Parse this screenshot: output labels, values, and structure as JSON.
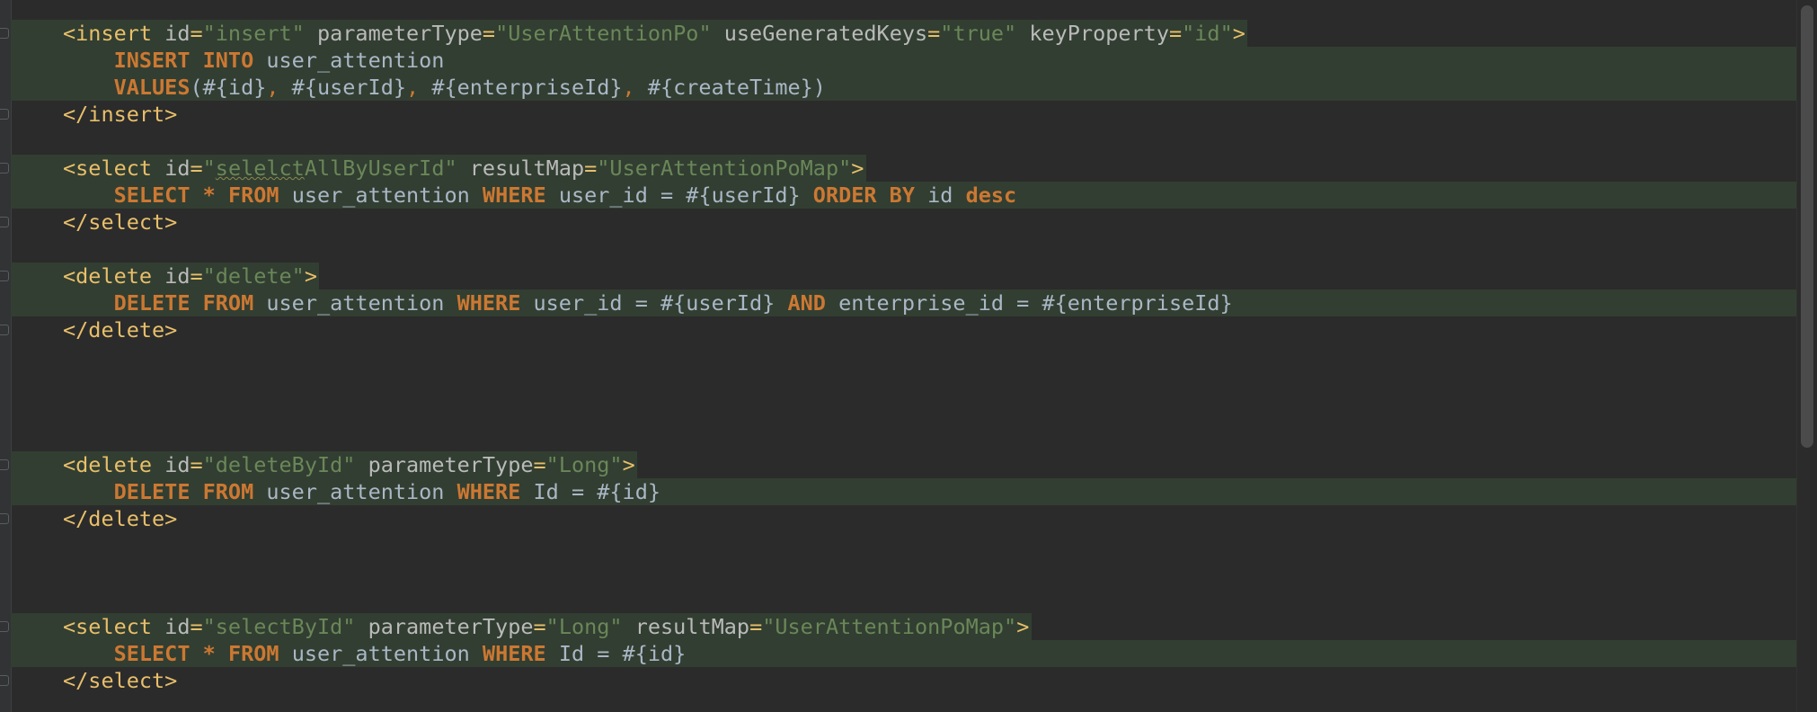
{
  "editor": {
    "language": "xml-mybatis-mapper",
    "colors": {
      "background": "#2b2b2b",
      "highlight": "#323e31",
      "tag": "#e8bf6a",
      "attribute": "#bababa",
      "string": "#6a8759",
      "keyword": "#cc7832",
      "text": "#a9b7c6"
    }
  },
  "lines": [
    {
      "tokens": [
        {
          "t": "tag",
          "v": "<insert "
        },
        {
          "t": "attr",
          "v": "id"
        },
        {
          "t": "tag",
          "v": "="
        },
        {
          "t": "val",
          "v": "\"insert\""
        },
        {
          "t": "plain",
          "v": " "
        },
        {
          "t": "attr",
          "v": "parameterType"
        },
        {
          "t": "tag",
          "v": "="
        },
        {
          "t": "val",
          "v": "\"UserAttentionPo\""
        },
        {
          "t": "plain",
          "v": " "
        },
        {
          "t": "attr",
          "v": "useGeneratedKeys"
        },
        {
          "t": "tag",
          "v": "="
        },
        {
          "t": "val",
          "v": "\"true\""
        },
        {
          "t": "plain",
          "v": " "
        },
        {
          "t": "attr",
          "v": "keyProperty"
        },
        {
          "t": "tag",
          "v": "="
        },
        {
          "t": "val",
          "v": "\"id\""
        },
        {
          "t": "tag",
          "v": ">"
        }
      ],
      "highlight": "partial",
      "fold": true
    },
    {
      "tokens": [
        {
          "t": "plain",
          "v": "    "
        },
        {
          "t": "kw",
          "v": "INSERT INTO"
        },
        {
          "t": "plain",
          "v": " user_attention"
        }
      ],
      "highlight": "full"
    },
    {
      "tokens": [
        {
          "t": "plain",
          "v": "    "
        },
        {
          "t": "kw",
          "v": "VALUES"
        },
        {
          "t": "plain",
          "v": "(#{id}"
        },
        {
          "t": "punc",
          "v": ", "
        },
        {
          "t": "plain",
          "v": "#{userId}"
        },
        {
          "t": "punc",
          "v": ", "
        },
        {
          "t": "plain",
          "v": "#{enterpriseId}"
        },
        {
          "t": "punc",
          "v": ", "
        },
        {
          "t": "plain",
          "v": "#{createTime})"
        }
      ],
      "highlight": "full"
    },
    {
      "tokens": [
        {
          "t": "tag",
          "v": "</insert>"
        }
      ],
      "highlight": "none",
      "fold": true
    },
    {
      "tokens": [],
      "highlight": "none"
    },
    {
      "tokens": [
        {
          "t": "tag",
          "v": "<select "
        },
        {
          "t": "attr",
          "v": "id"
        },
        {
          "t": "tag",
          "v": "="
        },
        {
          "t": "val",
          "v": "\""
        },
        {
          "t": "valwarn",
          "v": "selelct"
        },
        {
          "t": "val",
          "v": "AllByUserId\""
        },
        {
          "t": "plain",
          "v": " "
        },
        {
          "t": "attr",
          "v": "resultMap"
        },
        {
          "t": "tag",
          "v": "="
        },
        {
          "t": "val",
          "v": "\"UserAttentionPoMap\""
        },
        {
          "t": "tag",
          "v": ">"
        }
      ],
      "highlight": "partial",
      "fold": true
    },
    {
      "tokens": [
        {
          "t": "plain",
          "v": "    "
        },
        {
          "t": "kw",
          "v": "SELECT"
        },
        {
          "t": "plain",
          "v": " "
        },
        {
          "t": "kw",
          "v": "*"
        },
        {
          "t": "plain",
          "v": " "
        },
        {
          "t": "kw",
          "v": "FROM"
        },
        {
          "t": "plain",
          "v": " user_attention "
        },
        {
          "t": "kw",
          "v": "WHERE"
        },
        {
          "t": "plain",
          "v": " user_id = #{userId} "
        },
        {
          "t": "kw",
          "v": "ORDER BY"
        },
        {
          "t": "plain",
          "v": " id "
        },
        {
          "t": "kw",
          "v": "desc"
        }
      ],
      "highlight": "full"
    },
    {
      "tokens": [
        {
          "t": "tag",
          "v": "</select>"
        }
      ],
      "highlight": "none",
      "fold": true
    },
    {
      "tokens": [],
      "highlight": "none"
    },
    {
      "tokens": [
        {
          "t": "tag",
          "v": "<delete "
        },
        {
          "t": "attr",
          "v": "id"
        },
        {
          "t": "tag",
          "v": "="
        },
        {
          "t": "val",
          "v": "\"delete\""
        },
        {
          "t": "tag",
          "v": ">"
        }
      ],
      "highlight": "partial",
      "fold": true
    },
    {
      "tokens": [
        {
          "t": "plain",
          "v": "    "
        },
        {
          "t": "kw",
          "v": "DELETE FROM"
        },
        {
          "t": "plain",
          "v": " user_attention "
        },
        {
          "t": "kw",
          "v": "WHERE"
        },
        {
          "t": "plain",
          "v": " user_id = #{userId} "
        },
        {
          "t": "kw",
          "v": "AND"
        },
        {
          "t": "plain",
          "v": " enterprise_id = #{enterpriseId}"
        }
      ],
      "highlight": "full"
    },
    {
      "tokens": [
        {
          "t": "tag",
          "v": "</delete>"
        }
      ],
      "highlight": "none",
      "fold": true
    },
    {
      "tokens": [],
      "highlight": "none"
    },
    {
      "tokens": [],
      "highlight": "none"
    },
    {
      "tokens": [],
      "highlight": "none"
    },
    {
      "tokens": [],
      "highlight": "none"
    },
    {
      "tokens": [
        {
          "t": "tag",
          "v": "<delete "
        },
        {
          "t": "attr",
          "v": "id"
        },
        {
          "t": "tag",
          "v": "="
        },
        {
          "t": "val",
          "v": "\"deleteById\""
        },
        {
          "t": "plain",
          "v": " "
        },
        {
          "t": "attr",
          "v": "parameterType"
        },
        {
          "t": "tag",
          "v": "="
        },
        {
          "t": "val",
          "v": "\"Long\""
        },
        {
          "t": "tag",
          "v": ">"
        }
      ],
      "highlight": "partial",
      "fold": true
    },
    {
      "tokens": [
        {
          "t": "plain",
          "v": "    "
        },
        {
          "t": "kw",
          "v": "DELETE FROM"
        },
        {
          "t": "plain",
          "v": " user_attention "
        },
        {
          "t": "kw",
          "v": "WHERE"
        },
        {
          "t": "plain",
          "v": " Id = #{id}"
        }
      ],
      "highlight": "full"
    },
    {
      "tokens": [
        {
          "t": "tag",
          "v": "</delete>"
        }
      ],
      "highlight": "none",
      "fold": true
    },
    {
      "tokens": [],
      "highlight": "none"
    },
    {
      "tokens": [],
      "highlight": "none"
    },
    {
      "tokens": [],
      "highlight": "none"
    },
    {
      "tokens": [
        {
          "t": "tag",
          "v": "<select "
        },
        {
          "t": "attr",
          "v": "id"
        },
        {
          "t": "tag",
          "v": "="
        },
        {
          "t": "val",
          "v": "\"selectById\""
        },
        {
          "t": "plain",
          "v": " "
        },
        {
          "t": "attr",
          "v": "parameterType"
        },
        {
          "t": "tag",
          "v": "="
        },
        {
          "t": "val",
          "v": "\"Long\""
        },
        {
          "t": "plain",
          "v": " "
        },
        {
          "t": "attr",
          "v": "resultMap"
        },
        {
          "t": "tag",
          "v": "="
        },
        {
          "t": "val",
          "v": "\"UserAttentionPoMap\""
        },
        {
          "t": "tag",
          "v": ">"
        }
      ],
      "highlight": "partial",
      "fold": true
    },
    {
      "tokens": [
        {
          "t": "plain",
          "v": "    "
        },
        {
          "t": "kw",
          "v": "SELECT"
        },
        {
          "t": "plain",
          "v": " "
        },
        {
          "t": "kw",
          "v": "*"
        },
        {
          "t": "plain",
          "v": " "
        },
        {
          "t": "kw",
          "v": "FROM"
        },
        {
          "t": "plain",
          "v": " user_attention "
        },
        {
          "t": "kw",
          "v": "WHERE"
        },
        {
          "t": "plain",
          "v": " Id = #{id}"
        }
      ],
      "highlight": "full"
    },
    {
      "tokens": [
        {
          "t": "tag",
          "v": "</select>"
        }
      ],
      "highlight": "none",
      "fold": true
    }
  ]
}
